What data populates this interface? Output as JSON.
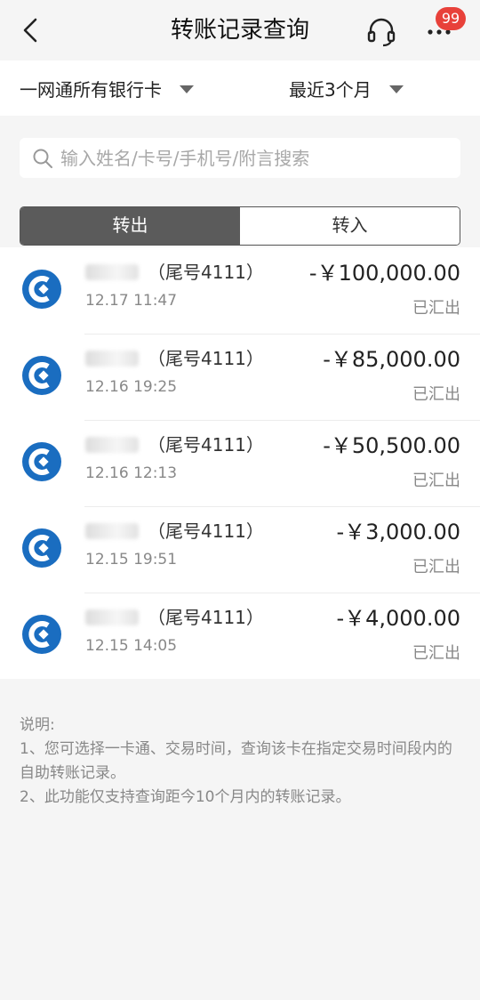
{
  "header": {
    "title": "转账记录查询",
    "badge_count": "99",
    "back_icon": "chevron-left-icon",
    "service_icon": "headset-icon",
    "more_icon": "more-dots-icon"
  },
  "filters": {
    "card_label": "一网通所有银行卡",
    "period_label": "最近3个月"
  },
  "search": {
    "placeholder": "输入姓名/卡号/手机号/附言搜索"
  },
  "tabs": [
    {
      "label": "转出",
      "active": true
    },
    {
      "label": "转入",
      "active": false
    }
  ],
  "transactions": [
    {
      "payee_suffix": "（尾号4111）",
      "date": "12.17 11:47",
      "amount": "-￥100,000.00",
      "status": "已汇出"
    },
    {
      "payee_suffix": "（尾号4111）",
      "date": "12.16 19:25",
      "amount": "-￥85,000.00",
      "status": "已汇出"
    },
    {
      "payee_suffix": "（尾号4111）",
      "date": "12.16 12:13",
      "amount": "-￥50,500.00",
      "status": "已汇出"
    },
    {
      "payee_suffix": "（尾号4111）",
      "date": "12.15 19:51",
      "amount": "-￥3,000.00",
      "status": "已汇出"
    },
    {
      "payee_suffix": "（尾号4111）",
      "date": "12.15 14:05",
      "amount": "-￥4,000.00",
      "status": "已汇出"
    }
  ],
  "notes": {
    "heading": "说明:",
    "line1": "1、您可选择一卡通、交易时间，查询该卡在指定交易时间段内的自助转账记录。",
    "line2": "2、此功能仅支持查询距今10个月内的转账记录。"
  },
  "colors": {
    "bank_blue": "#1a6dc0",
    "badge_red": "#e8413a",
    "tab_active": "#5b5b5b"
  }
}
